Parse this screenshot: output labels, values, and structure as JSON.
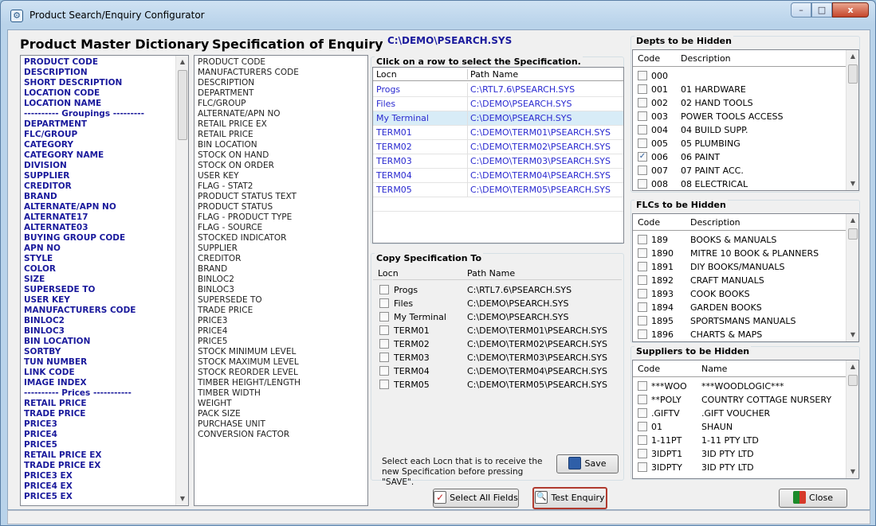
{
  "window": {
    "title": "Product Search/Enquiry Configurator",
    "min": "–",
    "max": "□",
    "close": "x"
  },
  "master": {
    "heading": "Product Master Dictionary",
    "items": [
      "PRODUCT CODE",
      "DESCRIPTION",
      "SHORT DESCRIPTION",
      "LOCATION CODE",
      "LOCATION NAME",
      "---------- Groupings ---------",
      "DEPARTMENT",
      "FLC/GROUP",
      "CATEGORY",
      "CATEGORY NAME",
      "DIVISION",
      "SUPPLIER",
      "CREDITOR",
      "BRAND",
      "ALTERNATE/APN NO",
      "ALTERNATE17",
      "ALTERNATE03",
      "BUYING GROUP CODE",
      "APN NO",
      "STYLE",
      "COLOR",
      "SIZE",
      "SUPERSEDE TO",
      "USER KEY",
      "MANUFACTURERS CODE",
      "BINLOC2",
      "BINLOC3",
      "BIN LOCATION",
      "SORTBY",
      "TUN NUMBER",
      "LINK CODE",
      "IMAGE INDEX",
      "---------- Prices -----------",
      "RETAIL PRICE",
      "TRADE PRICE",
      "PRICE3",
      "PRICE4",
      "PRICE5",
      "RETAIL PRICE EX",
      "TRADE PRICE EX",
      "PRICE3 EX",
      "PRICE4 EX",
      "PRICE5 EX"
    ]
  },
  "spec": {
    "heading": "Specification of Enquiry",
    "items": [
      "PRODUCT CODE",
      "MANUFACTURERS CODE",
      "DESCRIPTION",
      "DEPARTMENT",
      "FLC/GROUP",
      "ALTERNATE/APN NO",
      "RETAIL PRICE EX",
      "RETAIL PRICE",
      "BIN LOCATION",
      "STOCK ON HAND",
      "STOCK ON ORDER",
      "USER KEY",
      "FLAG - STAT2",
      "PRODUCT STATUS TEXT",
      "PRODUCT STATUS",
      "FLAG - PRODUCT TYPE",
      "FLAG - SOURCE",
      "STOCKED INDICATOR",
      "SUPPLIER",
      "CREDITOR",
      "BRAND",
      "BINLOC2",
      "BINLOC3",
      "SUPERSEDE TO",
      "TRADE PRICE",
      "PRICE3",
      "PRICE4",
      "PRICE5",
      "STOCK MINIMUM LEVEL",
      "STOCK MAXIMUM LEVEL",
      "STOCK REORDER LEVEL",
      "TIMBER HEIGHT/LENGTH",
      "TIMBER WIDTH",
      "WEIGHT",
      "PACK SIZE",
      "PURCHASE UNIT",
      "CONVERSION FACTOR"
    ]
  },
  "current_path": "C:\\DEMO\\PSEARCH.SYS",
  "select_spec": {
    "title": "Click on a row to select the Specification.",
    "col_locn": "Locn",
    "col_path": "Path Name",
    "rows": [
      {
        "locn": "Progs",
        "path": "C:\\RTL7.6\\PSEARCH.SYS"
      },
      {
        "locn": "Files",
        "path": "C:\\DEMO\\PSEARCH.SYS"
      },
      {
        "locn": "My Terminal",
        "path": "C:\\DEMO\\PSEARCH.SYS"
      },
      {
        "locn": "TERM01",
        "path": "C:\\DEMO\\TERM01\\PSEARCH.SYS"
      },
      {
        "locn": "TERM02",
        "path": "C:\\DEMO\\TERM02\\PSEARCH.SYS"
      },
      {
        "locn": "TERM03",
        "path": "C:\\DEMO\\TERM03\\PSEARCH.SYS"
      },
      {
        "locn": "TERM04",
        "path": "C:\\DEMO\\TERM04\\PSEARCH.SYS"
      },
      {
        "locn": "TERM05",
        "path": "C:\\DEMO\\TERM05\\PSEARCH.SYS"
      }
    ]
  },
  "copy_spec": {
    "title": "Copy Specification To",
    "col_locn": "Locn",
    "col_path": "Path Name",
    "rows": [
      {
        "locn": "Progs",
        "path": "C:\\RTL7.6\\PSEARCH.SYS"
      },
      {
        "locn": "Files",
        "path": "C:\\DEMO\\PSEARCH.SYS"
      },
      {
        "locn": "My Terminal",
        "path": "C:\\DEMO\\PSEARCH.SYS"
      },
      {
        "locn": "TERM01",
        "path": "C:\\DEMO\\TERM01\\PSEARCH.SYS"
      },
      {
        "locn": "TERM02",
        "path": "C:\\DEMO\\TERM02\\PSEARCH.SYS"
      },
      {
        "locn": "TERM03",
        "path": "C:\\DEMO\\TERM03\\PSEARCH.SYS"
      },
      {
        "locn": "TERM04",
        "path": "C:\\DEMO\\TERM04\\PSEARCH.SYS"
      },
      {
        "locn": "TERM05",
        "path": "C:\\DEMO\\TERM05\\PSEARCH.SYS"
      }
    ],
    "note": "Select each Locn that is to receive the new Specification before pressing \"SAVE\".",
    "save_label": "Save"
  },
  "depts": {
    "title": "Depts to be Hidden",
    "col_code": "Code",
    "col_desc": "Description",
    "rows": [
      {
        "code": "000",
        "desc": "",
        "checked": false
      },
      {
        "code": "001",
        "desc": "01 HARDWARE",
        "checked": false
      },
      {
        "code": "002",
        "desc": "02 HAND TOOLS",
        "checked": false
      },
      {
        "code": "003",
        "desc": "POWER TOOLS ACCESS",
        "checked": false
      },
      {
        "code": "004",
        "desc": "04 BUILD SUPP.",
        "checked": false
      },
      {
        "code": "005",
        "desc": "05 PLUMBING",
        "checked": false
      },
      {
        "code": "006",
        "desc": "06 PAINT",
        "checked": true
      },
      {
        "code": "007",
        "desc": "07 PAINT ACC.",
        "checked": false
      },
      {
        "code": "008",
        "desc": "08 ELECTRICAL",
        "checked": false
      }
    ]
  },
  "flcs": {
    "title": "FLCs to be Hidden",
    "col_code": "Code",
    "col_desc": "Description",
    "rows": [
      {
        "code": "189",
        "desc": "BOOKS & MANUALS"
      },
      {
        "code": "1890",
        "desc": "MITRE 10 BOOK & PLANNERS"
      },
      {
        "code": "1891",
        "desc": "DIY BOOKS/MANUALS"
      },
      {
        "code": "1892",
        "desc": "CRAFT MANUALS"
      },
      {
        "code": "1893",
        "desc": "COOK BOOKS"
      },
      {
        "code": "1894",
        "desc": "GARDEN BOOKS"
      },
      {
        "code": "1895",
        "desc": "SPORTSMANS MANUALS"
      },
      {
        "code": "1896",
        "desc": "CHARTS & MAPS"
      }
    ]
  },
  "suppliers": {
    "title": "Suppliers to be Hidden",
    "col_code": "Code",
    "col_desc": "Name",
    "rows": [
      {
        "code": "***WOO",
        "desc": "***WOODLOGIC***"
      },
      {
        "code": "**POLY",
        "desc": "COUNTRY COTTAGE NURSERY"
      },
      {
        "code": ".GIFTV",
        "desc": ".GIFT VOUCHER"
      },
      {
        "code": "01",
        "desc": "SHAUN"
      },
      {
        "code": "1-11PT",
        "desc": "1-11 PTY LTD"
      },
      {
        "code": "3IDPT1",
        "desc": "3ID PTY LTD"
      },
      {
        "code": "3IDPTY",
        "desc": "3ID PTY LTD"
      }
    ]
  },
  "buttons": {
    "select_all": "Select All Fields",
    "test_enquiry": "Test Enquiry",
    "close": "Close"
  }
}
